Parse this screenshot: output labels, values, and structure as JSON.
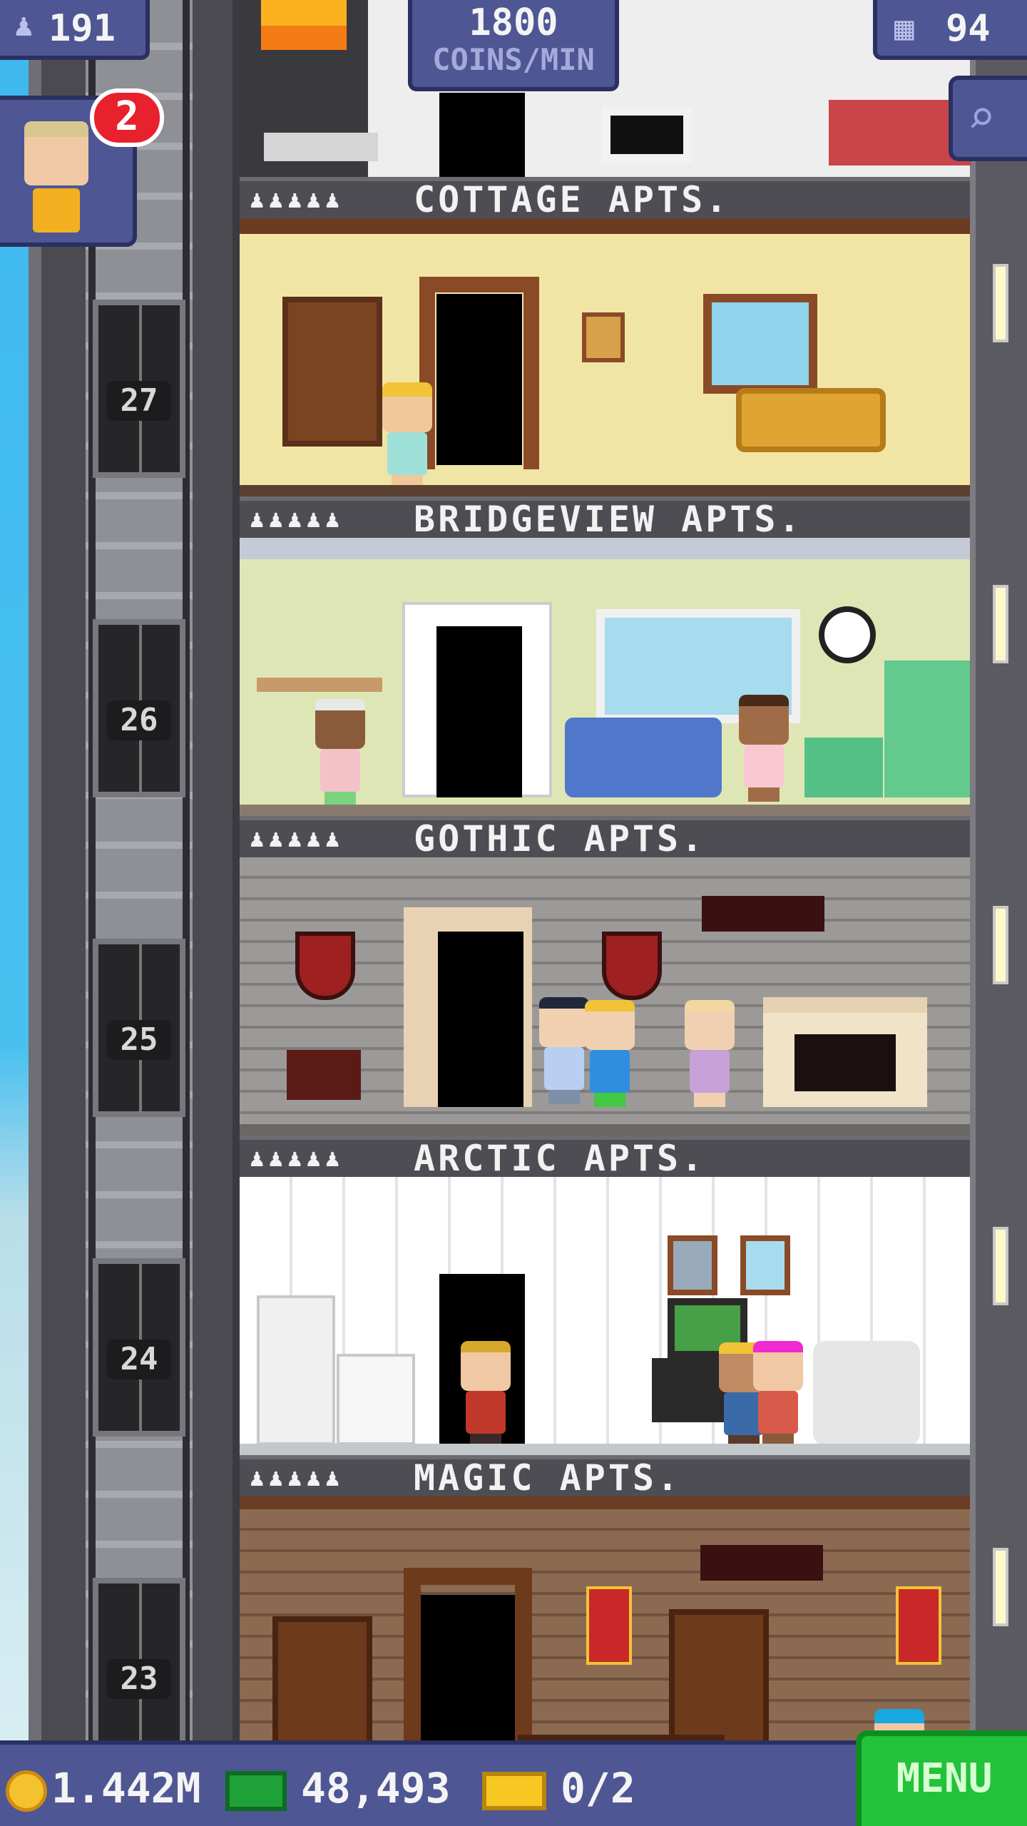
{
  "hud": {
    "population": "191",
    "coins_rate": "1800",
    "coins_rate_unit": "COINS/MIN",
    "floor_count": "94",
    "visitor_badge": "2"
  },
  "floors": [
    {
      "number": "27",
      "name": "COTTAGE APTS.",
      "stars": "♟♟♟♟♟",
      "theme": "cottage"
    },
    {
      "number": "26",
      "name": "BRIDGEVIEW APTS.",
      "stars": "♟♟♟♟♟",
      "theme": "bridgeview"
    },
    {
      "number": "25",
      "name": "GOTHIC APTS.",
      "stars": "♟♟♟♟♟",
      "theme": "gothic"
    },
    {
      "number": "24",
      "name": "ARCTIC APTS.",
      "stars": "♟♟♟♟♟",
      "theme": "arctic"
    },
    {
      "number": "23",
      "name": "MAGIC APTS.",
      "stars": "♟♟♟♟♟",
      "theme": "magic"
    }
  ],
  "bottom": {
    "coins": "1.442M",
    "bux": "48,493",
    "tickets": "0/2",
    "menu_label": "MENU"
  },
  "icons": {
    "population": "person-icon",
    "floors": "building-icon",
    "search": "magnifier-icon",
    "coins": "coin-icon",
    "bux": "bux-icon",
    "tickets": "ticket-icon"
  },
  "colors": {
    "hud_panel": "#4e5694",
    "hud_border": "#2b3062",
    "badge": "#e8222c",
    "menu": "#22c23a"
  }
}
